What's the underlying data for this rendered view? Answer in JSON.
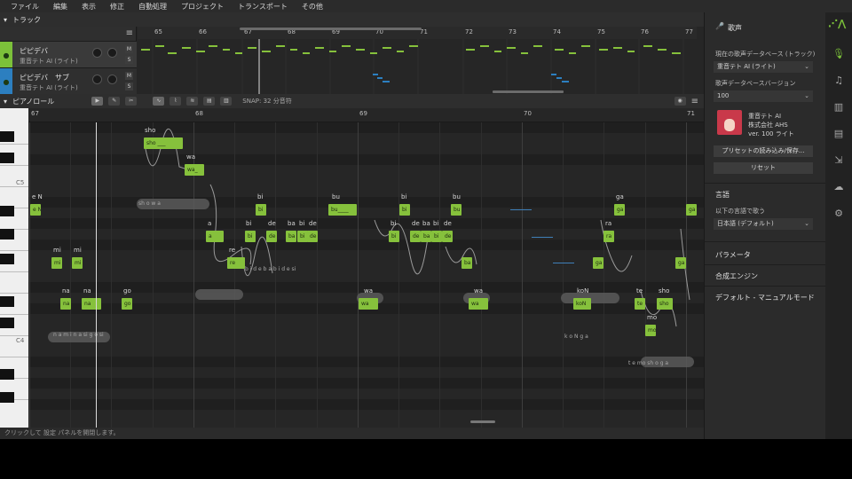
{
  "menu": [
    "ファイル",
    "編集",
    "表示",
    "修正",
    "自動処理",
    "プロジェクト",
    "トランスポート",
    "その他"
  ],
  "tracks_header": "トラック",
  "tracks": [
    {
      "name": "ピピデバ",
      "voice": "重音テト AI (ライト)",
      "color": "#7cc13a"
    },
    {
      "name": "ピピデバ　サブ",
      "voice": "重音テト AI (ライト)",
      "color": "#2c7fc0"
    }
  ],
  "track_ruler": [
    "65",
    "66",
    "67",
    "68",
    "69",
    "70",
    "71",
    "72",
    "73",
    "74",
    "75",
    "76",
    "77"
  ],
  "piano_roll_title": "ピアノロール",
  "snap_label": "SNAP: 32 分音符",
  "roll_ruler": [
    "67",
    "68",
    "69",
    "70",
    "71"
  ],
  "key_labels": {
    "c5": "C5",
    "c4": "C4"
  },
  "notes": [
    {
      "lyric": "sho",
      "text": "sho ___",
      "phon": "sh o w a"
    },
    {
      "lyric": "wa",
      "text": "wa_"
    },
    {
      "lyric": "e N",
      "text": "e N"
    },
    {
      "lyric": "a",
      "text": "a"
    },
    {
      "lyric": "re",
      "text": "re"
    },
    {
      "lyric": "bi",
      "text": "bi"
    },
    {
      "lyric": "de",
      "text": "de"
    },
    {
      "lyric": "ba",
      "text": "ba"
    },
    {
      "lyric": "bu",
      "text": "bu____"
    },
    {
      "lyric": "mi",
      "text": "mi"
    },
    {
      "lyric": "na",
      "text": "na"
    },
    {
      "lyric": "go",
      "text": "go"
    },
    {
      "lyric": "koN",
      "text": "koN"
    },
    {
      "lyric": "te",
      "text": "te"
    },
    {
      "lyric": "mo",
      "text": "mo"
    },
    {
      "lyric": "ga",
      "text": "ga"
    },
    {
      "lyric": "ra",
      "text": "ra"
    }
  ],
  "phonemes": {
    "row1": "n a m i n a  si   g o  si",
    "row2": "b i d e b a b i d e  si",
    "row3": "t e mo sh o  g a",
    "row4": "k o N g a"
  },
  "status_text": "クリックして 設定 パネルを開閉します。",
  "right_panel": {
    "title": "歌声",
    "db_label": "現在の歌声データベース (トラック)",
    "db_value": "重音テト AI (ライト)",
    "version_label": "歌声データベースバージョン",
    "version_value": "100",
    "voice_name": "重音テト AI",
    "company": "株式会社 AHS",
    "voice_version": "ver. 100 ライト",
    "preset_button": "プリセットの読み込み/保存...",
    "reset_button": "リセット",
    "language_title": "言語",
    "language_label": "以下の言語で歌う",
    "language_value": "日本語 (デフォルト)",
    "section_params": "パラメータ",
    "section_engine": "合成エンジン",
    "section_mode": "デフォルト - マニュアルモード"
  },
  "colors": {
    "accent": "#86c13c",
    "sub_track": "#2c7fc0",
    "bg": "#262626"
  }
}
